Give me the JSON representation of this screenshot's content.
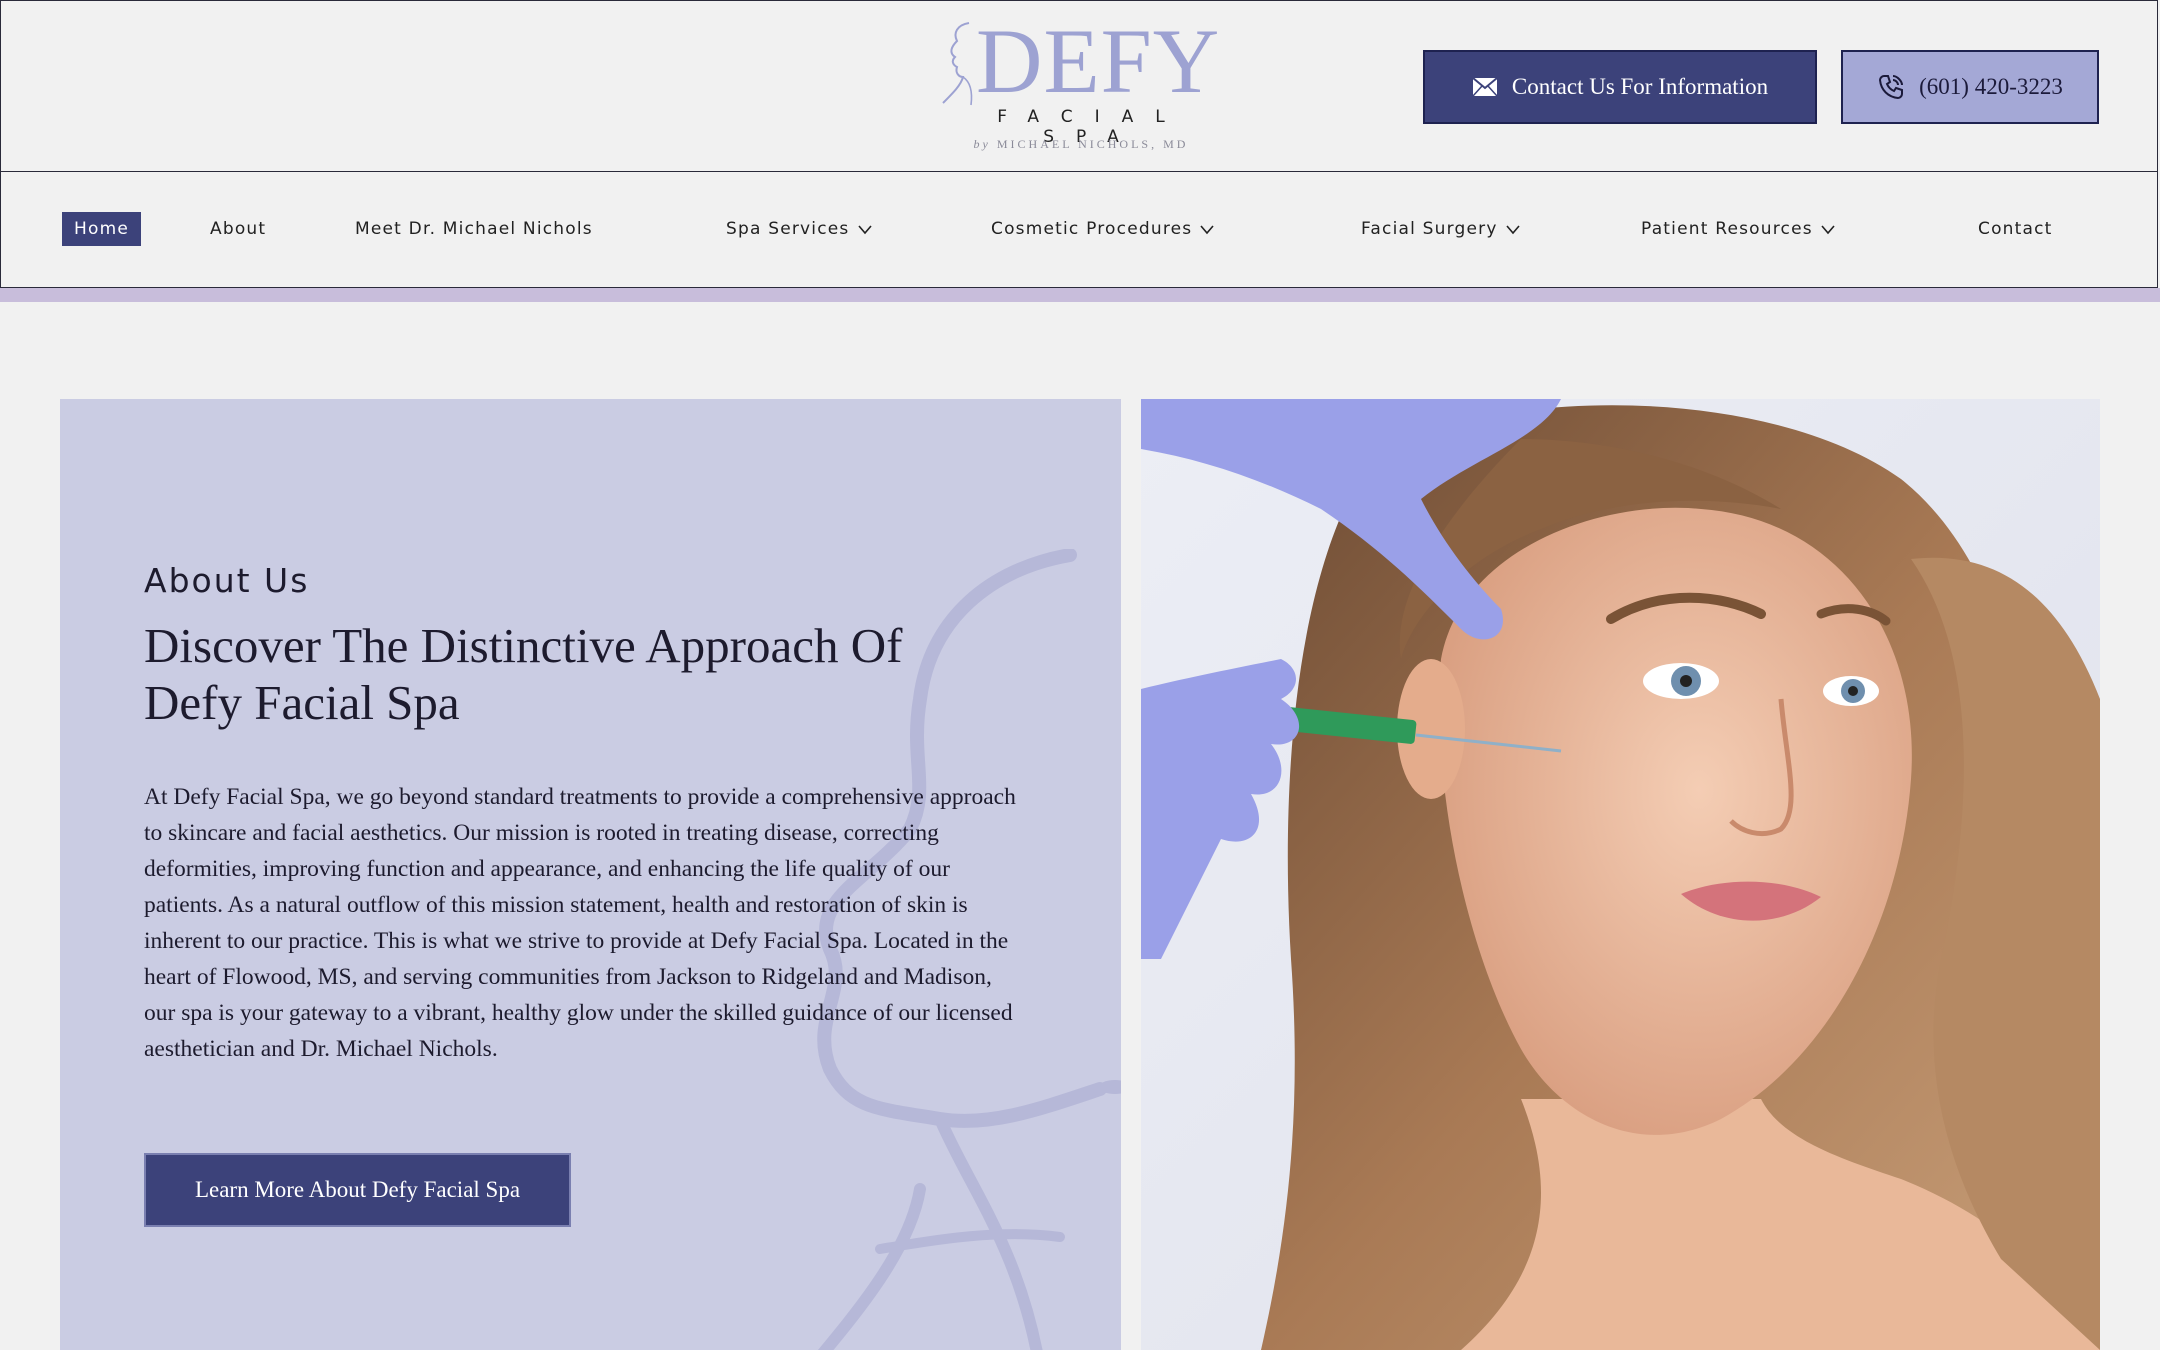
{
  "header": {
    "logo_word": "DEFY",
    "logo_sub": "FACIAL SPA",
    "logo_by_prefix": "by",
    "logo_by_name": "MICHAEL NICHOLS, MD",
    "contact_button": "Contact Us For Information",
    "phone_button": "(601) 420-3223",
    "contact_icon": "mail-icon",
    "phone_icon": "phone-icon"
  },
  "nav": {
    "items": [
      {
        "label": "Home",
        "active": true
      },
      {
        "label": "About"
      },
      {
        "label": "Meet Dr. Michael Nichols"
      },
      {
        "label": "Spa Services",
        "dropdown": true
      },
      {
        "label": "Cosmetic Procedures",
        "dropdown": true
      },
      {
        "label": "Facial Surgery",
        "dropdown": true
      },
      {
        "label": "Patient Resources",
        "dropdown": true
      },
      {
        "label": "Contact"
      }
    ]
  },
  "about": {
    "eyebrow": "About Us",
    "title": "Discover The Distinctive Approach Of Defy Facial Spa",
    "body": "At Defy Facial Spa, we go beyond standard treatments to provide a comprehensive approach to skincare and facial aesthetics. Our mission is rooted in treating disease, correcting deformities, improving function and appearance, and enhancing the life quality of our patients. As a natural outflow of this mission statement, health and restoration of skin is inherent to our practice. This is what we strive to provide at Defy Facial Spa. Located in the heart of Flowood, MS, and serving communities from Jackson to Ridgeland and Madison, our spa is your gateway to a vibrant, healthy glow under the skilled guidance of our licensed aesthetician and Dr. Michael Nichols.",
    "button": "Learn More About Defy Facial Spa"
  },
  "colors": {
    "brand_dark": "#3c427a",
    "brand_light": "#a4a8d6",
    "panel": "#cacce3",
    "accent_strip": "#c8bddb"
  }
}
